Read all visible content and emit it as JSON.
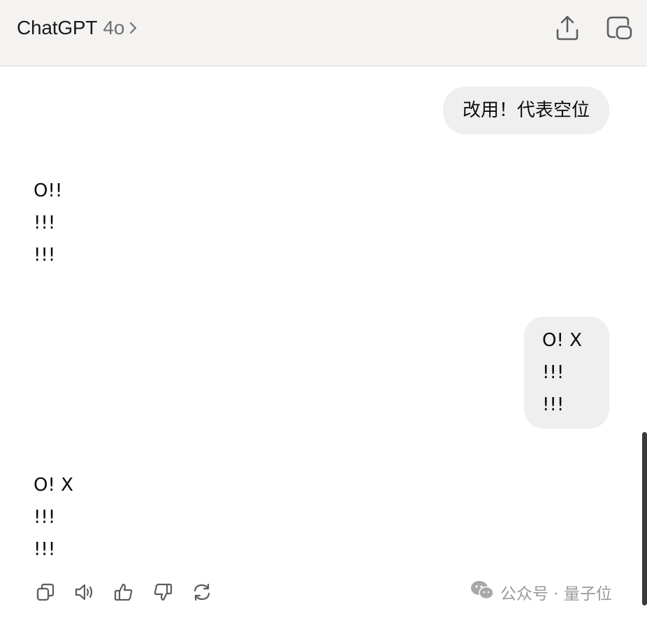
{
  "header": {
    "app_name": "ChatGPT",
    "model_name": "4o",
    "icons": [
      "chevron-right-icon",
      "share-icon",
      "new-chat-icon"
    ]
  },
  "conversation": {
    "user_message_1": "改用！代表空位",
    "assistant_board_1": [
      "O!!",
      "!!!",
      "!!!"
    ],
    "user_message_2": [
      "O! X",
      "!!!",
      "!!!"
    ],
    "assistant_board_2": [
      "O! X",
      "!!!",
      "!!!"
    ]
  },
  "message_actions": [
    "copy-icon",
    "read-aloud-icon",
    "thumbs-up-icon",
    "thumbs-down-icon",
    "regenerate-icon"
  ],
  "watermark": {
    "text": "公众号 · 量子位"
  },
  "colors": {
    "header_bg": "#f4f3f1",
    "bubble_bg": "#efefef",
    "text": "#0d0d0d",
    "icon": "#5d5d5d"
  }
}
